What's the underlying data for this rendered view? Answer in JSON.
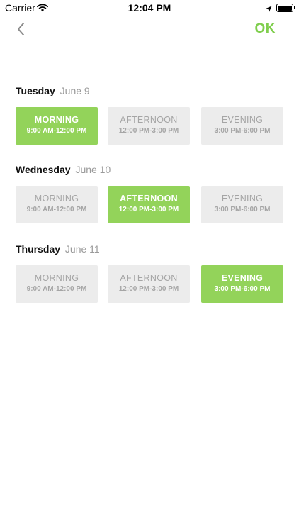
{
  "status_bar": {
    "carrier": "Carrier",
    "time": "12:04 PM"
  },
  "nav": {
    "back_icon": "chevron-left-icon",
    "ok_label": "OK"
  },
  "colors": {
    "accent": "#7fce4d",
    "selected_slot": "#93d35a",
    "unselected_slot": "#ececec"
  },
  "days": [
    {
      "weekday": "Tuesday",
      "date": "June 9",
      "selected": "morning",
      "slots": [
        {
          "label": "MORNING",
          "range": "9:00 AM-12:00 PM"
        },
        {
          "label": "AFTERNOON",
          "range": "12:00 PM-3:00 PM"
        },
        {
          "label": "EVENING",
          "range": "3:00 PM-6:00 PM"
        }
      ]
    },
    {
      "weekday": "Wednesday",
      "date": "June 10",
      "selected": "afternoon",
      "slots": [
        {
          "label": "MORNING",
          "range": "9:00 AM-12:00 PM"
        },
        {
          "label": "AFTERNOON",
          "range": "12:00 PM-3:00 PM"
        },
        {
          "label": "EVENING",
          "range": "3:00 PM-6:00 PM"
        }
      ]
    },
    {
      "weekday": "Thursday",
      "date": "June 11",
      "selected": "evening",
      "slots": [
        {
          "label": "MORNING",
          "range": "9:00 AM-12:00 PM"
        },
        {
          "label": "AFTERNOON",
          "range": "12:00 PM-3:00 PM"
        },
        {
          "label": "EVENING",
          "range": "3:00 PM-6:00 PM"
        }
      ]
    }
  ]
}
